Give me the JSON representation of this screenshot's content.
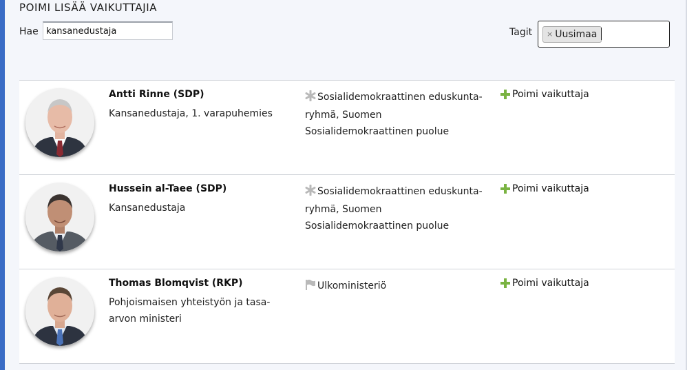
{
  "header": {
    "title": "POIMI LISÄÄ VAIKUTTAJIA",
    "search_label": "Hae",
    "search_value": "kansanedustaja",
    "tags_label": "Tagit",
    "tags": [
      {
        "label": "Uusimaa",
        "remove_glyph": "×"
      }
    ]
  },
  "people": [
    {
      "name": "Antti Rinne (SDP)",
      "role": "Kansanedustaja, 1. varapuhemies",
      "org_icon": "asterisk-icon",
      "org": "Sosialidemokraattinen eduskunta­ryhmä, Suomen Sosialidemokraattinen puolue",
      "action": "Poimi vaikuttaja"
    },
    {
      "name": "Hussein al-Taee (SDP)",
      "role": "Kansanedustaja",
      "org_icon": "asterisk-icon",
      "org": "Sosialidemokraattinen eduskunta­ryhmä, Suomen Sosialidemokraattinen puolue",
      "action": "Poimi vaikuttaja"
    },
    {
      "name": "Thomas Blomqvist (RKP)",
      "role": "Pohjoismaisen yhteistyön ja tasa-arvon ministeri",
      "org_icon": "flag-icon",
      "org": "Ulkoministeriö",
      "action": "Poimi vaikuttaja"
    }
  ],
  "colors": {
    "accent_bar": "#3a6cc6",
    "plus": "#7ab342",
    "icon_gray": "#b9b9b9"
  }
}
